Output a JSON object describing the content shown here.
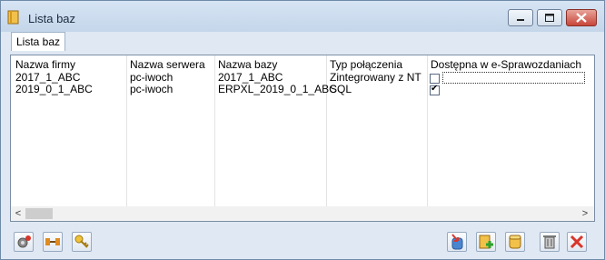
{
  "window": {
    "title": "Lista baz"
  },
  "tabs": [
    {
      "label": "Lista baz"
    }
  ],
  "table": {
    "columns": [
      "Nazwa firmy",
      "Nazwa serwera",
      "Nazwa bazy",
      "Typ połączenia",
      "Dostępna w e-Sprawozdaniach"
    ],
    "rows": [
      {
        "firma": "2017_1_ABC",
        "serwer": "pc-iwoch",
        "baza": "2017_1_ABC",
        "typ": "Zintegrowany z NT",
        "dostepna": false
      },
      {
        "firma": "2019_0_1_ABC",
        "serwer": "pc-iwoch",
        "baza": "ERPXL_2019_0_1_ABC",
        "typ": "SQL",
        "dostepna": true
      }
    ]
  },
  "colors": {
    "accent": "#6f8aa8",
    "background": "#dfe8f3",
    "close": "#c8463a"
  }
}
